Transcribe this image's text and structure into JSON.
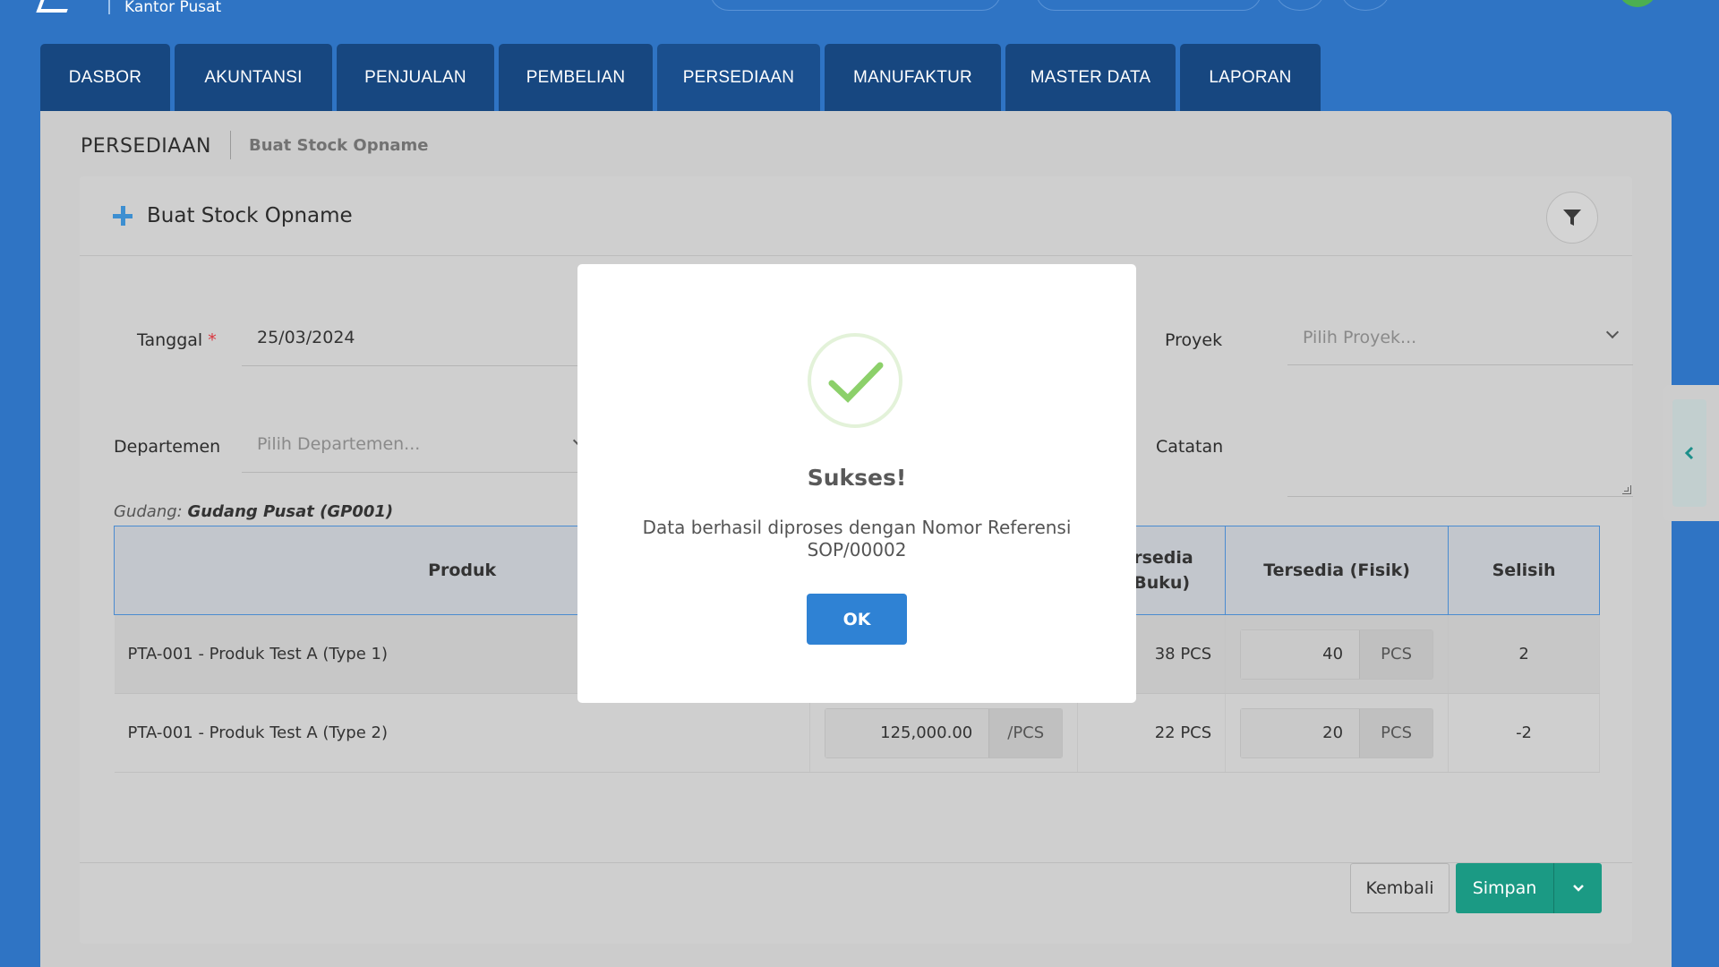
{
  "header": {
    "branch": "Kantor Pusat"
  },
  "nav": {
    "tabs": [
      {
        "label": "DASBOR"
      },
      {
        "label": "AKUNTANSI"
      },
      {
        "label": "PENJUALAN"
      },
      {
        "label": "PEMBELIAN"
      },
      {
        "label": "PERSEDIAAN"
      },
      {
        "label": "MANUFAKTUR"
      },
      {
        "label": "MASTER DATA"
      },
      {
        "label": "LAPORAN"
      }
    ]
  },
  "page": {
    "section": "PERSEDIAAN",
    "breadcrumb": "Buat Stock Opname",
    "card_title": "Buat Stock Opname"
  },
  "form": {
    "date_label": "Tanggal",
    "date_required": "*",
    "date_value": "25/03/2024",
    "project_label": "Proyek",
    "project_placeholder": "Pilih Proyek...",
    "department_label": "Departemen",
    "department_placeholder": "Pilih Departemen...",
    "notes_label": "Catatan",
    "warehouse_prefix": "Gudang:",
    "warehouse_value": "Gudang Pusat (GP001)"
  },
  "table": {
    "headers": {
      "product": "Produk",
      "book": "rsedia\nBuku)",
      "physical": "Tersedia (Fisik)",
      "diff": "Selisih"
    },
    "rows": [
      {
        "product": "PTA-001 - Produk Test A (Type 1)",
        "price": "",
        "price_unit": "",
        "book": "38 PCS",
        "physical": "40",
        "physical_unit": "PCS",
        "diff": "2"
      },
      {
        "product": "PTA-001 - Produk Test A (Type 2)",
        "price": "125,000.00",
        "price_unit": "/PCS",
        "book": "22 PCS",
        "physical": "20",
        "physical_unit": "PCS",
        "diff": "-2"
      }
    ]
  },
  "actions": {
    "back": "Kembali",
    "save": "Simpan"
  },
  "modal": {
    "title": "Sukses!",
    "message_line1": "Data berhasil diproses dengan Nomor Referensi",
    "message_line2": "SOP/00002",
    "ok": "OK",
    "success_color": "#8cd06a"
  },
  "colors": {
    "primary": "#2f74c4",
    "nav_tab": "#174780",
    "accent_save": "#1b9a84",
    "ok_button": "#2f82d4"
  }
}
